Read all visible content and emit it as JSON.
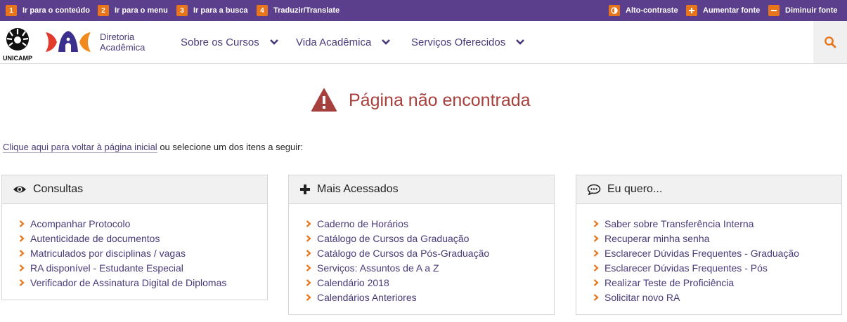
{
  "accessibility_bar": {
    "skip_links": [
      {
        "key": "1",
        "label": "Ir para o conteúdo"
      },
      {
        "key": "2",
        "label": "Ir para o menu"
      },
      {
        "key": "3",
        "label": "Ir para a busca"
      },
      {
        "key": "4",
        "label": "Traduzir/Translate"
      }
    ],
    "contrast_label": "Alto-contraste",
    "increase_font_label": "Aumentar fonte",
    "decrease_font_label": "Diminuir fonte"
  },
  "header": {
    "unicamp_logo_text": "UNICAMP",
    "site_name_line1": "Diretoria",
    "site_name_line2": "Acadêmica",
    "nav": [
      {
        "label": "Sobre os Cursos"
      },
      {
        "label": "Vida Acadêmica"
      },
      {
        "label": "Serviços Oferecidos"
      }
    ],
    "search_icon": "search-icon"
  },
  "main": {
    "error_title": "Página não encontrada",
    "intro_link": "Clique aqui para voltar à página inicial",
    "intro_rest": " ou selecione um dos itens a seguir:"
  },
  "panels": [
    {
      "title": "Consultas",
      "icon": "eye-icon",
      "items": [
        "Acompanhar Protocolo",
        "Autenticidade de documentos",
        "Matriculados por disciplinas / vagas",
        "RA disponível - Estudante Especial",
        "Verificador de Assinatura Digital de Diplomas"
      ]
    },
    {
      "title": "Mais Acessados",
      "icon": "plus-icon",
      "items": [
        "Caderno de Horários",
        "Catálogo de Cursos da Graduação",
        "Catálogo de Cursos da Pós-Graduação",
        "Serviços: Assuntos de A a Z",
        "Calendário 2018",
        "Calendários Anteriores"
      ]
    },
    {
      "title": "Eu quero...",
      "icon": "chat-icon",
      "items": [
        "Saber sobre Transferência Interna",
        "Recuperar minha senha",
        "Esclarecer Dúvidas Frequentes - Graduação",
        "Esclarecer Dúvidas Frequentes - Pós",
        "Realizar Teste de Proficiência",
        "Solicitar novo RA"
      ]
    }
  ],
  "colors": {
    "accessibility_bar": "#5b3f8c",
    "accent_orange": "#e8751a",
    "nav_text": "#4a3a7a",
    "error_red": "#a7403d"
  }
}
